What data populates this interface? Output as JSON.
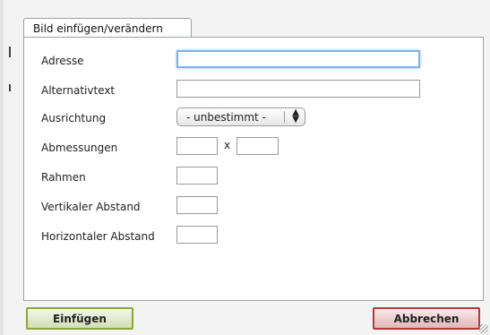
{
  "dialog": {
    "tab_label": "Bild einfügen/verändern"
  },
  "form": {
    "address": {
      "label": "Adresse",
      "value": ""
    },
    "alt_text": {
      "label": "Alternativtext",
      "value": ""
    },
    "alignment": {
      "label": "Ausrichtung",
      "selected": "- unbestimmt -"
    },
    "dimensions": {
      "label": "Abmessungen",
      "width": "",
      "height": "",
      "separator": "x"
    },
    "border": {
      "label": "Rahmen",
      "value": ""
    },
    "vspace": {
      "label": "Vertikaler Abstand",
      "value": ""
    },
    "hspace": {
      "label": "Horizontaler Abstand",
      "value": ""
    }
  },
  "buttons": {
    "insert": "Einfügen",
    "cancel": "Abbrechen"
  },
  "colors": {
    "insert_border": "#8aa83a",
    "cancel_border": "#b23a3a",
    "focus_ring": "#7fb2e6"
  }
}
